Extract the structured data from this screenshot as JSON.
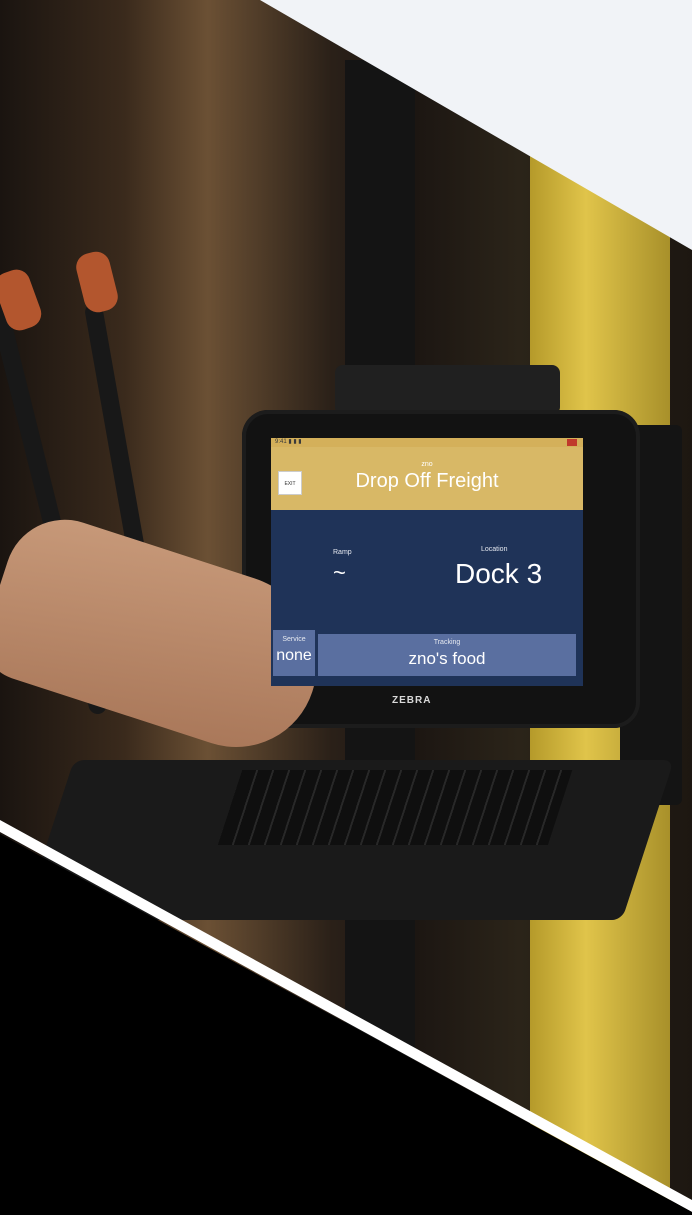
{
  "tablet": {
    "status_left": "9:41 ▮ ▮ ▮",
    "app_name": "zno",
    "title": "Drop Off Freight",
    "exit_label": "EXIT",
    "ramp_label": "Ramp",
    "ramp_value": "~",
    "location_label": "Location",
    "location_value": "Dock 3",
    "service_label": "Service",
    "service_value": "none",
    "tracking_label": "Tracking",
    "tracking_value": "zno's food"
  },
  "device_brand": "ZEBRA",
  "colors": {
    "header": "#d8b866",
    "body": "#1f3358",
    "button": "#5a6fa0",
    "top_band": "#f1f3f7"
  }
}
